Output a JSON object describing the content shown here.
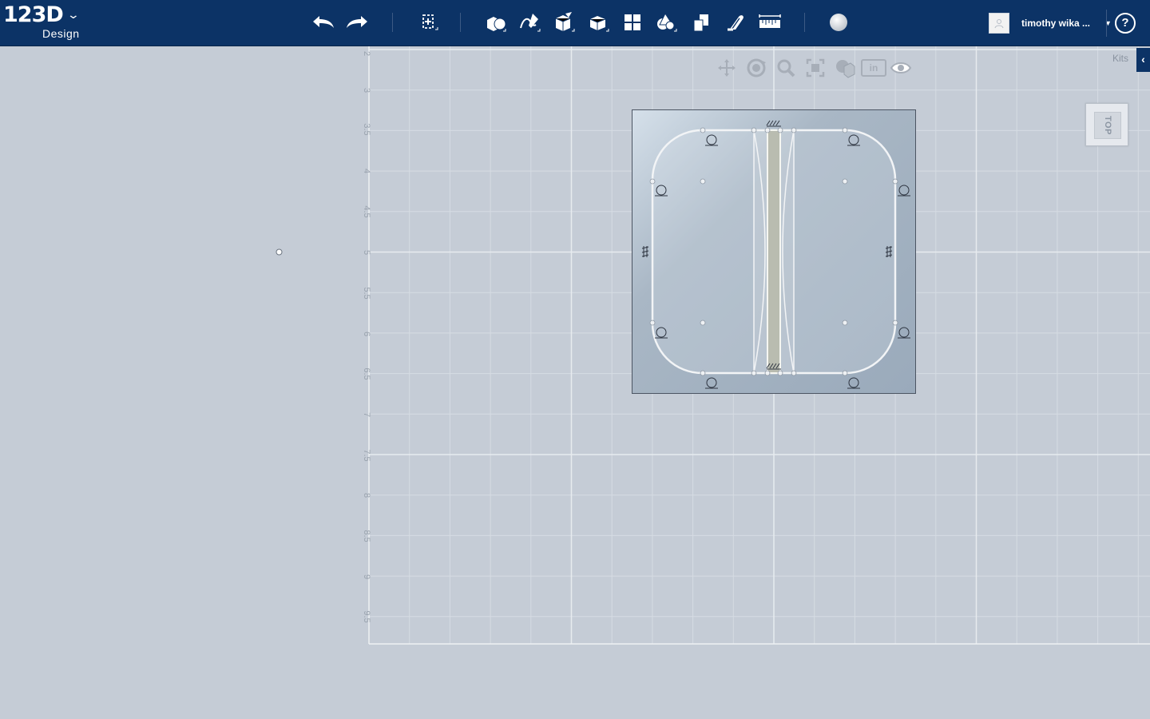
{
  "app": {
    "logo_main": "123D",
    "logo_sub": "Design"
  },
  "toolbar": {
    "tools": [
      {
        "name": "undo-button",
        "icon": "undo-icon"
      },
      {
        "name": "redo-button",
        "icon": "redo-icon"
      },
      {
        "name": "transform-button",
        "icon": "transform-icon"
      },
      {
        "name": "primitives-button",
        "icon": "primitives-icon"
      },
      {
        "name": "sketch-button",
        "icon": "sketch-icon"
      },
      {
        "name": "construct-button",
        "icon": "construct-icon"
      },
      {
        "name": "modify-button",
        "icon": "modify-icon"
      },
      {
        "name": "pattern-button",
        "icon": "pattern-icon"
      },
      {
        "name": "grouping-button",
        "icon": "grouping-icon"
      },
      {
        "name": "combine-button",
        "icon": "combine-icon"
      },
      {
        "name": "snap-button",
        "icon": "snap-icon"
      },
      {
        "name": "measure-button",
        "icon": "ruler-icon"
      },
      {
        "name": "material-button",
        "icon": "material-sphere-icon"
      }
    ]
  },
  "user": {
    "name": "timothy wika ..."
  },
  "help": {
    "label": "?"
  },
  "navigation": {
    "units_label": "in",
    "tools": [
      "pan-icon",
      "orbit-icon",
      "zoom-icon",
      "fit-icon",
      "view-mode-icon",
      "units-button",
      "visibility-eye-icon"
    ]
  },
  "kits": {
    "label": "Kits",
    "toggle": "‹"
  },
  "viewcube": {
    "label": "TOP"
  },
  "ruler": {
    "ticks": [
      "2",
      "3",
      "3.5",
      "4",
      "4.5",
      "5",
      "5.5",
      "6",
      "6.5",
      "7",
      "7.5",
      "8",
      "8.5",
      "9",
      "9.5"
    ]
  },
  "colors": {
    "header": "#0c3366",
    "canvas": "#c5ccd6",
    "grid": "#dde2e8"
  }
}
